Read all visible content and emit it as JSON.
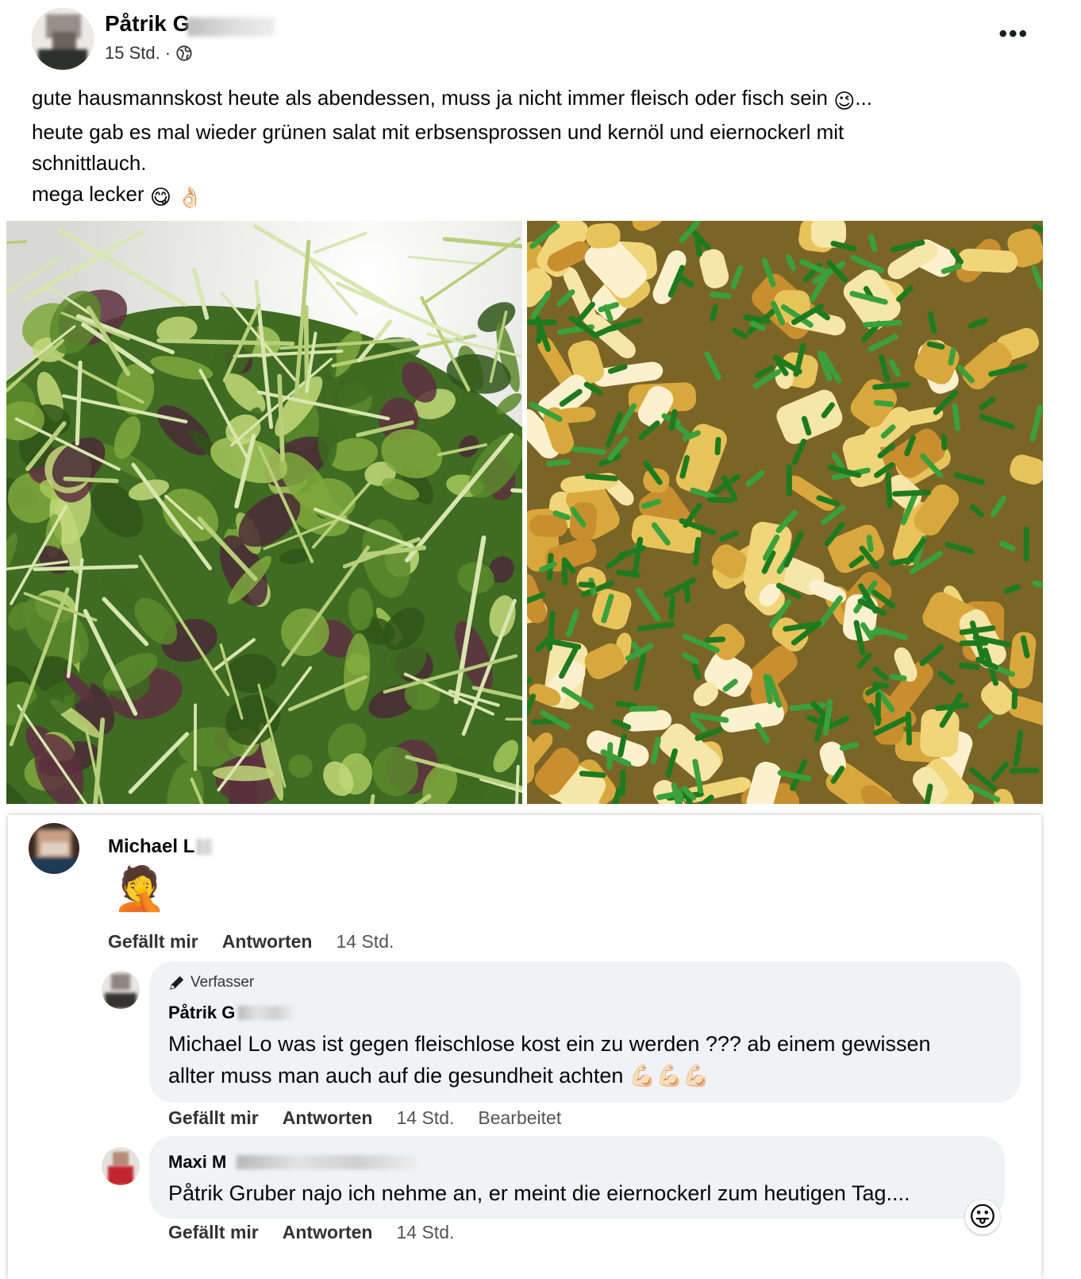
{
  "post": {
    "author_name": "Påtrik G",
    "timestamp": "15 Std.",
    "separator": "·",
    "more_label": "•••",
    "text_lines": [
      "gute hausmannskost heute als abendessen, muss ja nicht immer fleisch oder fisch sein",
      "heute gab es mal wieder grünen salat mit erbsensprossen und kernöl und eiernockerl mit",
      "schnittlauch.",
      "mega lecker"
    ],
    "line1_suffix": "...",
    "emoji_wink": "😉",
    "emoji_yum": "😋",
    "emoji_ok": "👌🏻",
    "photos": [
      "salad-photo",
      "eiernockerl-photo"
    ]
  },
  "comments": [
    {
      "author": "Michael L",
      "emoji": "🤦",
      "like": "Gefällt mir",
      "reply": "Antworten",
      "time": "14 Std."
    }
  ],
  "replies": [
    {
      "badge": "Verfasser",
      "author": "Påtrik G",
      "text_line1": "Michael Lo was ist gegen fleischlose kost ein zu werden ??? ab einem gewissen",
      "text_line2": "allter muss man auch auf die gesundheit achten",
      "emoji_flex": "💪🏻💪🏻💪🏻",
      "like": "Gefällt mir",
      "reply": "Antworten",
      "time": "14 Std.",
      "edited": "Bearbeitet"
    },
    {
      "author": "Maxi M",
      "text_line1": "Påtrik Gruber najo ich nehme an, er meint die eiernockerl zum heutigen Tag....",
      "reaction_emoji": "😛",
      "like": "Gefällt mir",
      "reply": "Antworten",
      "time": "14 Std."
    }
  ]
}
